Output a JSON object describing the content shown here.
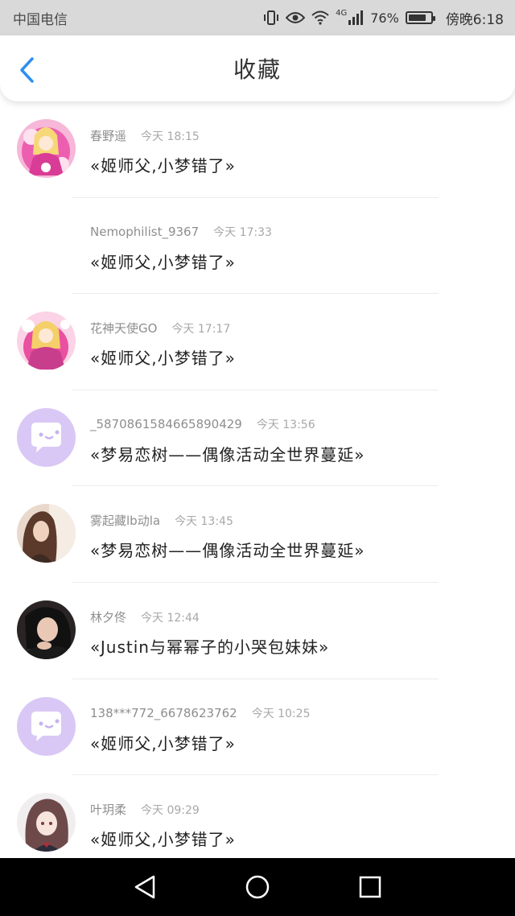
{
  "status_bar": {
    "carrier": "中国电信",
    "network": "4G",
    "battery": "76%",
    "time": "傍晚6:18",
    "icons": [
      "vibrate-icon",
      "eye-icon",
      "wifi-icon",
      "signal-icon",
      "battery-icon"
    ]
  },
  "header": {
    "title": "收藏",
    "back_icon": "chevron-left-icon",
    "accent": "#2f8ff0"
  },
  "items": [
    {
      "name": "春野遥",
      "time": "今天 18:15",
      "content": "«姬师父,小梦错了»",
      "avatar": "pink-character"
    },
    {
      "name": "Nemophilist_9367",
      "time": "今天 17:33",
      "content": "«姬师父,小梦错了»",
      "avatar": "none"
    },
    {
      "name": "花神天使GO",
      "time": "今天 17:17",
      "content": "«姬师父,小梦错了»",
      "avatar": "pink-character"
    },
    {
      "name": "_5870861584665890429",
      "time": "今天 13:56",
      "content": "«梦易恋树——偶像活动全世界蔓延»",
      "avatar": "default-chat"
    },
    {
      "name": "雾起藏lb动la",
      "time": "今天 13:45",
      "content": "«梦易恋树——偶像活动全世界蔓延»",
      "avatar": "photo-brown"
    },
    {
      "name": "林夕佟",
      "time": "今天 12:44",
      "content": "«Justin与幂幂子的小哭包妹妹»",
      "avatar": "photo-dark"
    },
    {
      "name": "138***772_6678623762",
      "time": "今天 10:25",
      "content": "«姬师父,小梦错了»",
      "avatar": "default-chat"
    },
    {
      "name": "叶玥柔",
      "time": "今天 09:29",
      "content": "«姬师父,小梦错了»",
      "avatar": "anime-girl"
    }
  ],
  "colors": {
    "status_bar_bg": "#d9d9d9",
    "default_avatar": "#d9c8f5",
    "name_text": "#8e8e8e",
    "content_text": "#222222",
    "nav_bg": "#000000"
  },
  "nav_bar": [
    "back-triangle-icon",
    "home-circle-icon",
    "recents-square-icon"
  ]
}
